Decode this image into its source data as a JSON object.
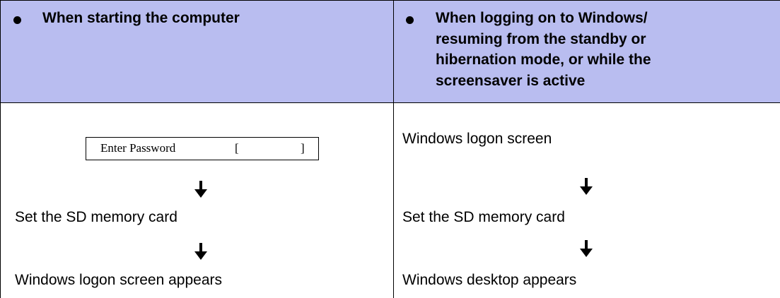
{
  "table": {
    "left_header": "When starting the computer",
    "right_header_lines": [
      "When logging on to Windows/",
      "resuming from the standby or",
      "hibernation mode, or while the",
      "screensaver is active"
    ],
    "left_steps": {
      "password_label": "Enter Password",
      "password_open": "[",
      "password_close": "]",
      "step2": "Set the SD memory card",
      "step3": "Windows logon screen appears"
    },
    "right_steps": {
      "step1": "Windows logon screen",
      "step2": "Set the SD memory card",
      "step3": "Windows desktop appears"
    },
    "colors": {
      "header_bg": "#b9bdf0"
    }
  }
}
